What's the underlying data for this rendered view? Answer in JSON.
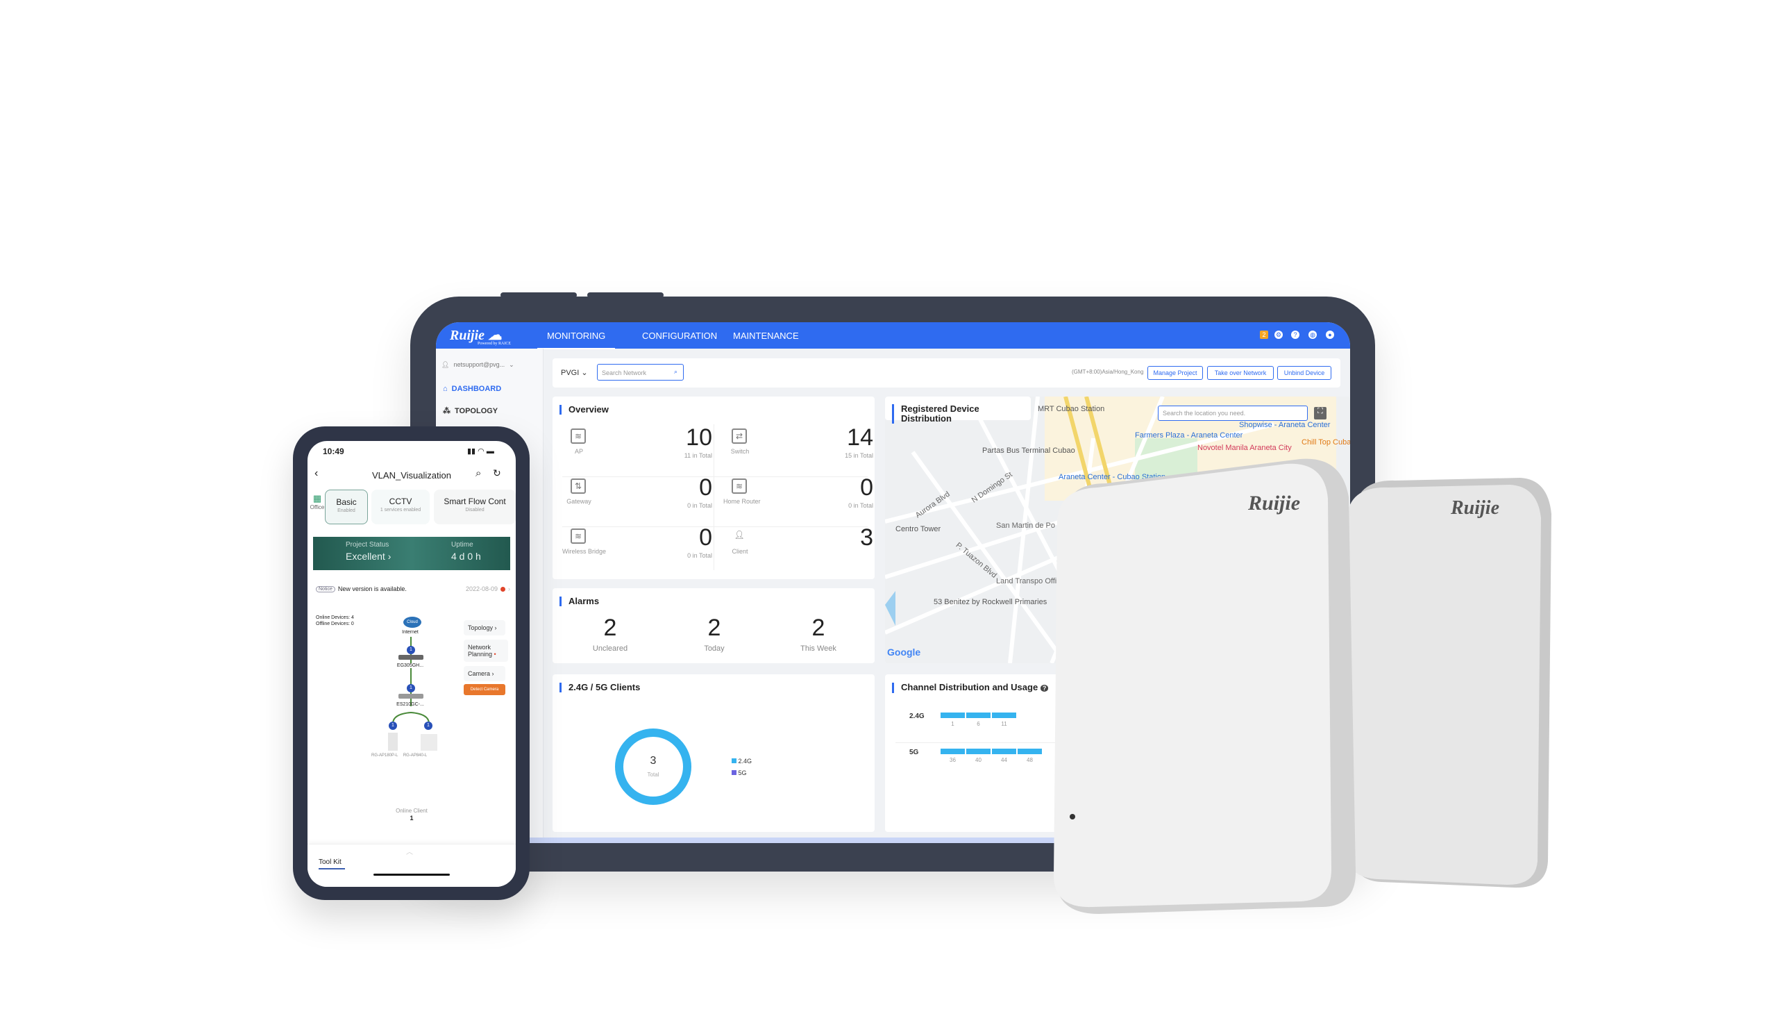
{
  "tablet": {
    "brand": "Ruijie",
    "brand_sub": "Powered by RAICE",
    "nav": [
      {
        "label": "MONITORING",
        "active": true
      },
      {
        "label": "CONFIGURATION"
      },
      {
        "label": "MAINTENANCE"
      }
    ],
    "notification_count": "2",
    "sidebar": {
      "user": "netsupport@pvg...",
      "items": [
        {
          "label": "DASHBOARD",
          "icon": "home-icon",
          "active": true
        },
        {
          "label": "TOPOLOGY",
          "icon": "topology-icon"
        }
      ]
    },
    "toolbar": {
      "network": "PVGI",
      "search_placeholder": "Search Network",
      "timezone": "(GMT+8:00)Asia/Hong_Kong",
      "buttons": [
        "Manage Project",
        "Take over Network",
        "Unbind Device"
      ]
    },
    "overview": {
      "title": "Overview",
      "items": [
        {
          "label": "AP",
          "value": "10",
          "total": "11 in Total",
          "icon": "ap-icon"
        },
        {
          "label": "Switch",
          "value": "14",
          "total": "15 in Total",
          "icon": "switch-icon"
        },
        {
          "label": "Gateway",
          "value": "0",
          "total": "0 in Total",
          "icon": "gateway-icon"
        },
        {
          "label": "Home Router",
          "value": "0",
          "total": "0 in Total",
          "icon": "router-icon"
        },
        {
          "label": "Wireless Bridge",
          "value": "0",
          "total": "0 in Total",
          "icon": "bridge-icon"
        },
        {
          "label": "Client",
          "value": "3",
          "total": "",
          "icon": "user-icon"
        }
      ]
    },
    "alarms": {
      "title": "Alarms",
      "items": [
        {
          "value": "2",
          "label": "Uncleared"
        },
        {
          "value": "2",
          "label": "Today"
        },
        {
          "value": "2",
          "label": "This Week"
        }
      ]
    },
    "clients": {
      "title": "2.4G / 5G Clients",
      "total": "3",
      "total_label": "Total",
      "legend": [
        {
          "label": "2.4G",
          "color": "#35b3ef"
        },
        {
          "label": "5G",
          "color": "#6b63e0"
        }
      ]
    },
    "map": {
      "title": "Registered Device Distribution",
      "search_placeholder": "Search the location you need.",
      "attribution": "Google",
      "labels": [
        {
          "text": "MRT Cubao Station",
          "color": "#555"
        },
        {
          "text": "Farmers Plaza - Araneta Center",
          "color": "#2a6fd6"
        },
        {
          "text": "Shopwise - Araneta Center",
          "color": "#2a6fd6"
        },
        {
          "text": "Novotel Manila Araneta City",
          "color": "#d23a5a"
        },
        {
          "text": "Chill Top Cuba Roofdeck Restol",
          "color": "#e07a16"
        },
        {
          "text": "Partas Bus Terminal Cubao",
          "color": "#555"
        },
        {
          "text": "Araneta Center - Cubao Station",
          "color": "#2a6fd6"
        },
        {
          "text": "Centro Tower",
          "color": "#555"
        },
        {
          "text": "San Martin de Po Barangay",
          "color": "#666"
        },
        {
          "text": "Land Transpo Office Quezo",
          "color": "#666"
        },
        {
          "text": "53 Benitez by Rockwell Primaries",
          "color": "#555"
        },
        {
          "text": "Aurora Blvd",
          "color": "#666"
        },
        {
          "text": "P. Tuazon Blvd",
          "color": "#666"
        },
        {
          "text": "N Domingo St",
          "color": "#666"
        }
      ]
    },
    "channels": {
      "title": "Channel Distribution and Usage",
      "bands": [
        {
          "label": "2.4G",
          "channels": [
            "1",
            "6",
            "11"
          ]
        },
        {
          "label": "5G",
          "channels": [
            "36",
            "40",
            "44",
            "48"
          ]
        }
      ],
      "bar_color": "#35b3ef"
    }
  },
  "phone": {
    "time": "10:49",
    "title": "VLAN_Visualization",
    "site": "Office",
    "tabs": [
      {
        "label": "Basic",
        "sub": "Enabled"
      },
      {
        "label": "CCTV",
        "sub": "1 services enabled"
      },
      {
        "label": "Smart Flow Cont",
        "sub": "Disabled"
      }
    ],
    "status_label": "Project Status",
    "status_value": "Excellent ›",
    "uptime_label": "Uptime",
    "uptime_value": "4 d 0 h",
    "notice_tag": "Notice",
    "notice_text": "New version is available.",
    "notice_date": "2022-08-09",
    "online_devices": "Online Devices: 4",
    "offline_devices": "Offline Devices: 0",
    "cloud_label": "Cloud",
    "topology": [
      {
        "label": "Internet"
      },
      {
        "label": "EG305GH..."
      },
      {
        "label": "ES210GC-..."
      }
    ],
    "aps": [
      "RG-AP180P-L",
      "RG-AP840-L"
    ],
    "link_count": "1",
    "right_buttons": [
      "Topology",
      "Network Planning",
      "Camera"
    ],
    "detect_camera": "Detect Camera",
    "online_client_label": "Online Client",
    "online_client_value": "1",
    "toolkit": "Tool Kit"
  },
  "devices": {
    "logo": "Ruijie"
  }
}
